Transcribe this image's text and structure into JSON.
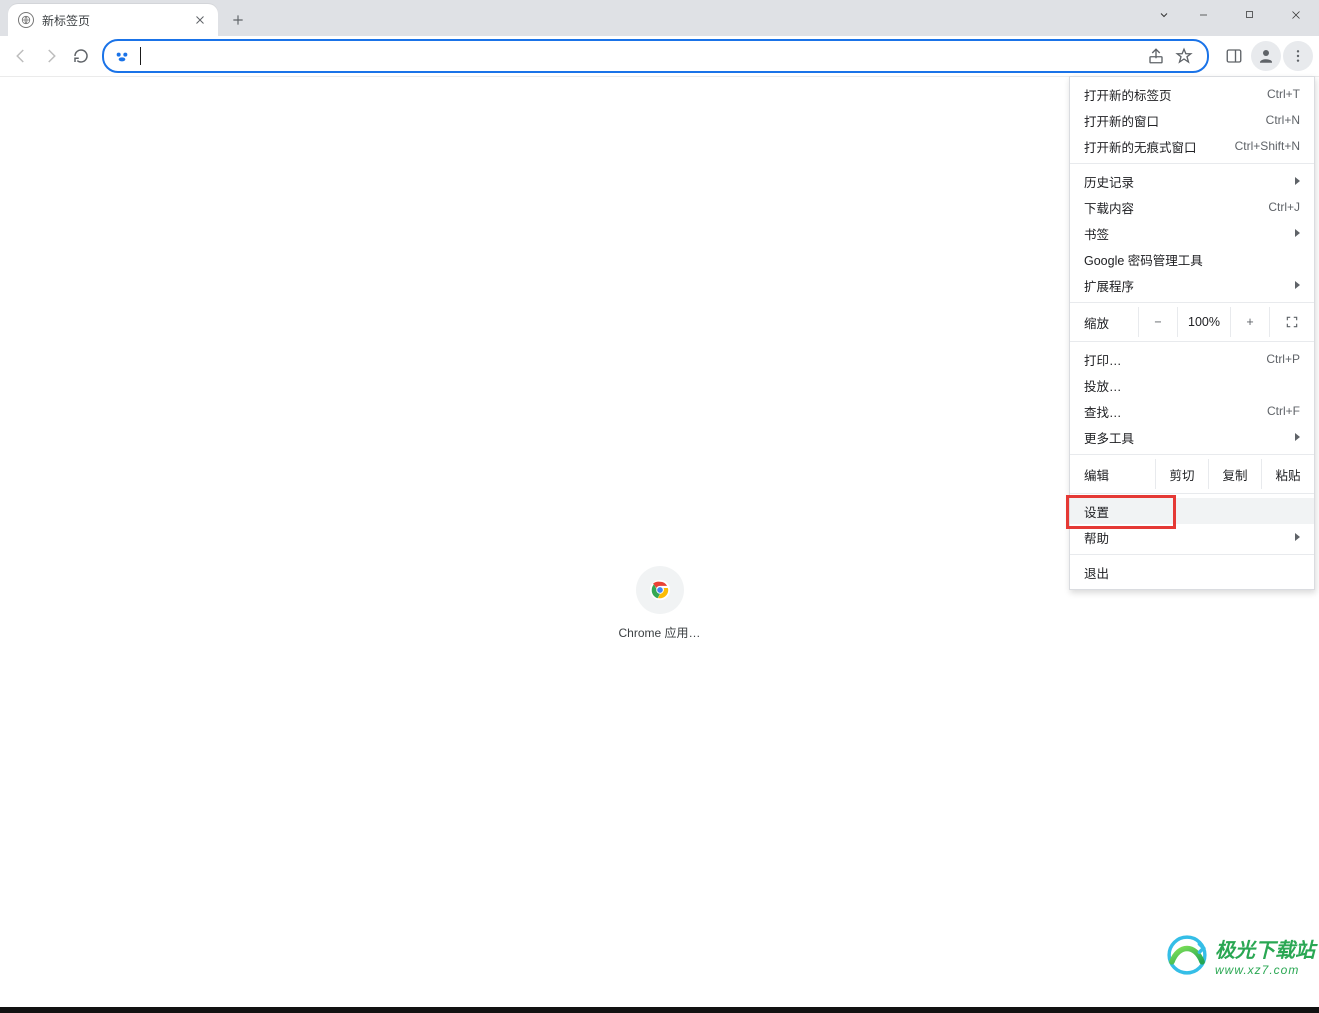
{
  "window": {
    "tab_title": "新标签页"
  },
  "toolbar": {
    "url_value": ""
  },
  "content": {
    "app_shortcut_label": "Chrome 应用…"
  },
  "menu": {
    "new_tab": {
      "label": "打开新的标签页",
      "shortcut": "Ctrl+T"
    },
    "new_window": {
      "label": "打开新的窗口",
      "shortcut": "Ctrl+N"
    },
    "new_incognito": {
      "label": "打开新的无痕式窗口",
      "shortcut": "Ctrl+Shift+N"
    },
    "history": {
      "label": "历史记录"
    },
    "downloads": {
      "label": "下载内容",
      "shortcut": "Ctrl+J"
    },
    "bookmarks": {
      "label": "书签"
    },
    "passwords": {
      "label": "Google 密码管理工具"
    },
    "extensions": {
      "label": "扩展程序"
    },
    "zoom": {
      "label": "缩放",
      "minus": "−",
      "value": "100%",
      "plus": "+"
    },
    "print": {
      "label": "打印…",
      "shortcut": "Ctrl+P"
    },
    "cast": {
      "label": "投放…"
    },
    "find": {
      "label": "查找…",
      "shortcut": "Ctrl+F"
    },
    "more_tools": {
      "label": "更多工具"
    },
    "edit": {
      "label": "编辑",
      "cut": "剪切",
      "copy": "复制",
      "paste": "粘贴"
    },
    "settings": {
      "label": "设置"
    },
    "help": {
      "label": "帮助"
    },
    "exit": {
      "label": "退出"
    }
  },
  "watermark": {
    "title": "极光下载站",
    "url": "www.xz7.com"
  }
}
